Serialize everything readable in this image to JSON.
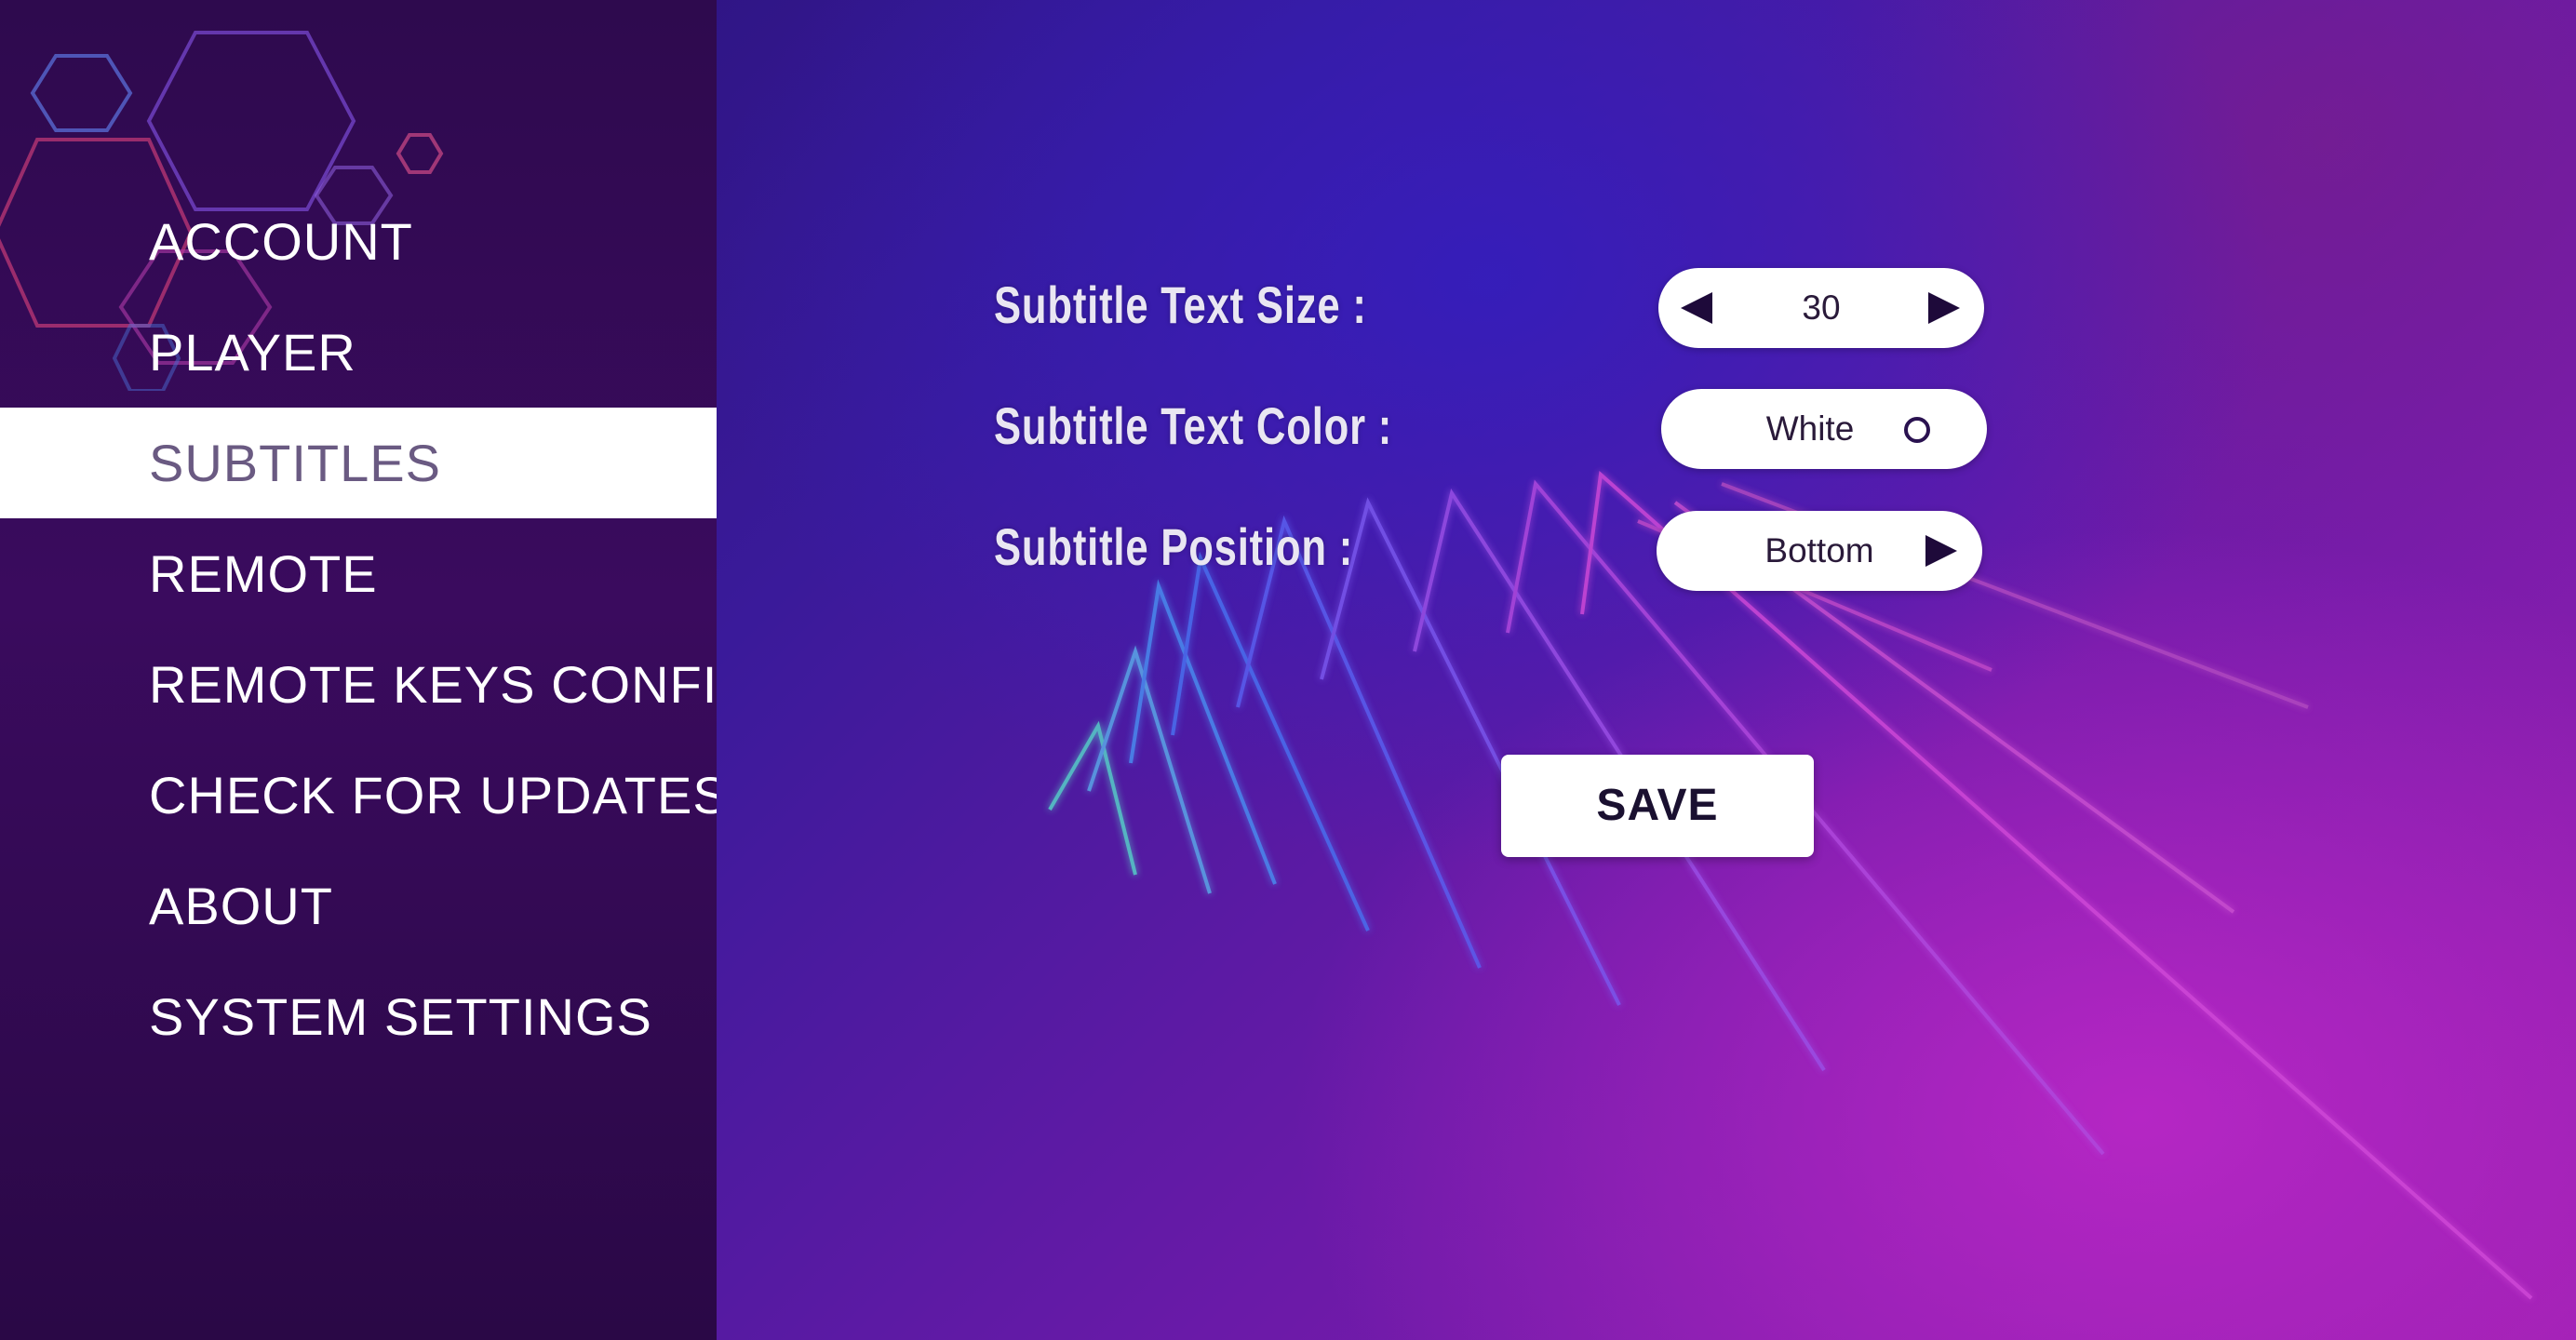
{
  "sidebar": {
    "items": [
      {
        "label": "ACCOUNT",
        "active": false
      },
      {
        "label": "PLAYER",
        "active": false
      },
      {
        "label": "SUBTITLES",
        "active": true
      },
      {
        "label": "REMOTE",
        "active": false
      },
      {
        "label": "REMOTE KEYS CONFIG",
        "active": false
      },
      {
        "label": "CHECK FOR UPDATES",
        "active": false
      },
      {
        "label": "ABOUT",
        "active": false
      },
      {
        "label": "SYSTEM SETTINGS",
        "active": false
      }
    ]
  },
  "settings": {
    "text_size": {
      "label": "Subtitle Text Size :",
      "value": "30",
      "icons": [
        "arrow-left-icon",
        "arrow-right-icon"
      ]
    },
    "text_color": {
      "label": "Subtitle Text Color :",
      "value": "White",
      "icons": [
        "radio-circle-icon"
      ]
    },
    "position": {
      "label": "Subtitle Position :",
      "value": "Bottom",
      "icons": [
        "arrow-right-icon"
      ]
    }
  },
  "save_button": {
    "label": "SAVE"
  },
  "colors": {
    "sidebar_bg": "#3a0b5e",
    "active_item_bg": "#ffffff",
    "active_item_text": "#6a5a82",
    "accent_blue": "#3a1a9a",
    "accent_magenta": "#b020c0"
  }
}
